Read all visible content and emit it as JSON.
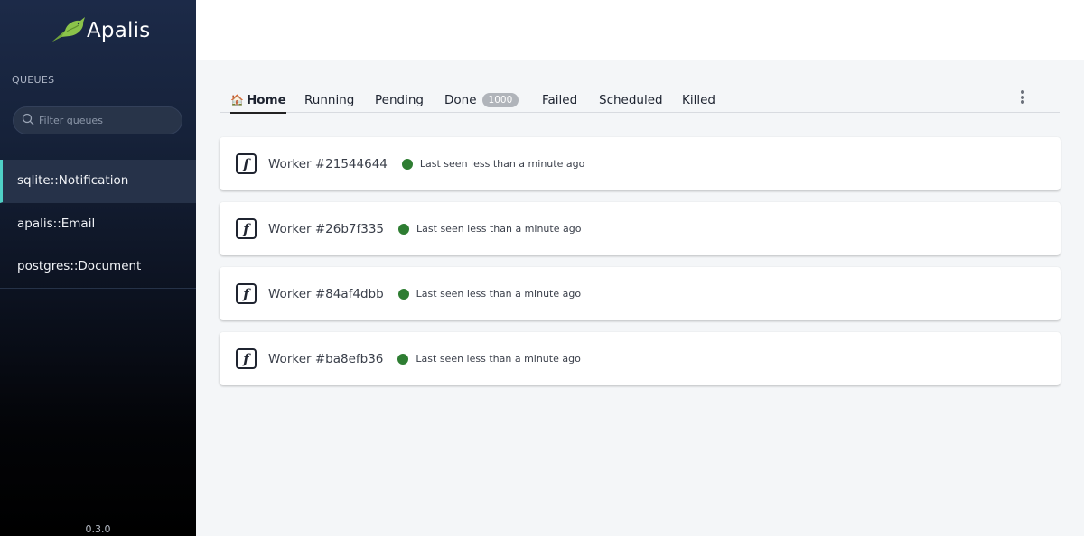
{
  "app": {
    "name": "Apalis",
    "version": "0.3.0"
  },
  "sidebar": {
    "section_title": "QUEUES",
    "filter_placeholder": "Filter queues",
    "queues": [
      {
        "label": "sqlite::Notification",
        "active": true
      },
      {
        "label": "apalis::Email",
        "active": false
      },
      {
        "label": "postgres::Document",
        "active": false
      }
    ]
  },
  "tabs": [
    {
      "label": "Home",
      "icon": "home-icon",
      "active": true
    },
    {
      "label": "Running"
    },
    {
      "label": "Pending"
    },
    {
      "label": "Done",
      "badge": "1000"
    },
    {
      "label": "Failed"
    },
    {
      "label": "Scheduled"
    },
    {
      "label": "Killed"
    }
  ],
  "workers": [
    {
      "name": "Worker #21544644",
      "status": "Last seen less than a minute ago",
      "status_color": "#2e7d32"
    },
    {
      "name": "Worker #26b7f335",
      "status": "Last seen less than a minute ago",
      "status_color": "#2e7d32"
    },
    {
      "name": "Worker #84af4dbb",
      "status": "Last seen less than a minute ago",
      "status_color": "#2e7d32"
    },
    {
      "name": "Worker #ba8efb36",
      "status": "Last seen less than a minute ago",
      "status_color": "#2e7d32"
    }
  ],
  "colors": {
    "accent": "#4fd0c6",
    "brand_green": "#8bc34a",
    "status_online": "#2e7d32"
  }
}
